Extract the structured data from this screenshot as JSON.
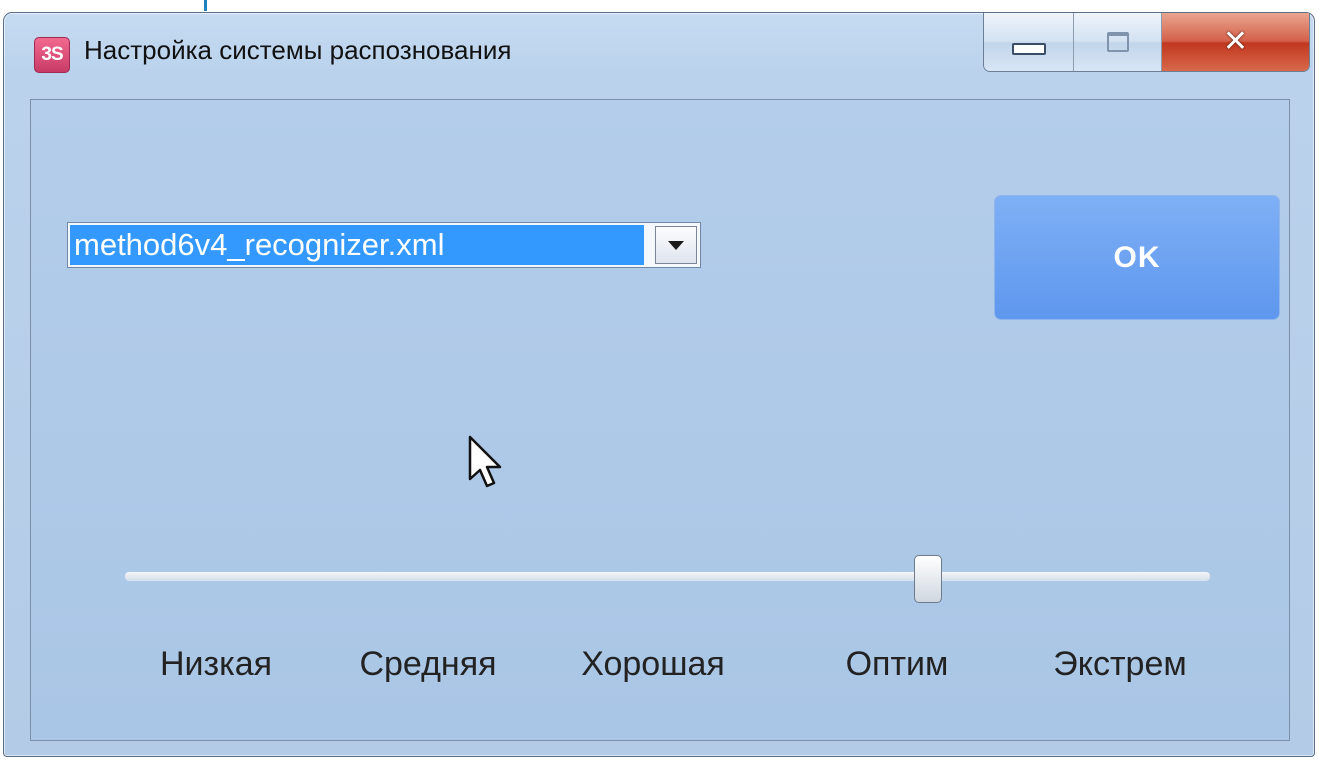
{
  "window": {
    "app_icon_text": "3S",
    "title": "Настройка системы распознования"
  },
  "recognizer_select": {
    "selected_value": "method6v4_recognizer.xml"
  },
  "ok_button": {
    "label": "OK"
  },
  "quality_slider": {
    "labels": [
      "Низкая",
      "Средняя",
      "Хорошая",
      "Оптим",
      "Экстрем"
    ],
    "value_fraction": 0.74
  },
  "colors": {
    "selection": "#3399ff",
    "ok_button": "#6ba3f2",
    "close_button": "#c9472e",
    "window_bg": "#b7cfea"
  }
}
